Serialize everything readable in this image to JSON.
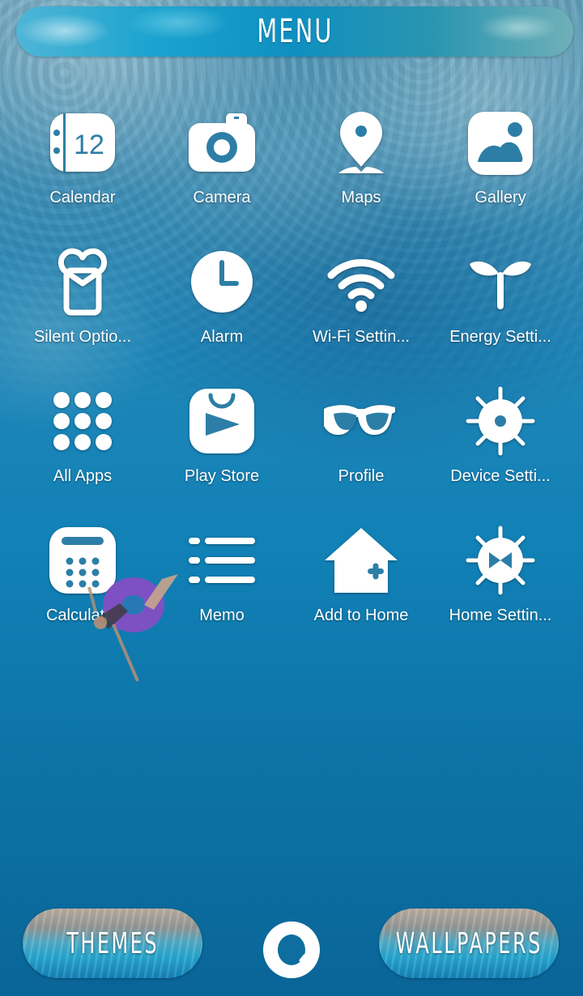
{
  "header": {
    "title": "MENU"
  },
  "apps": [
    {
      "label": "Calendar",
      "icon": "calendar-icon",
      "calendar_day": "12"
    },
    {
      "label": "Camera",
      "icon": "camera-icon"
    },
    {
      "label": "Maps",
      "icon": "map-pin-icon"
    },
    {
      "label": "Gallery",
      "icon": "gallery-icon"
    },
    {
      "label": "Silent Optio...",
      "icon": "silent-mode-icon"
    },
    {
      "label": "Alarm",
      "icon": "clock-icon"
    },
    {
      "label": "Wi-Fi Settin...",
      "icon": "wifi-icon"
    },
    {
      "label": "Energy Setti...",
      "icon": "sprout-icon"
    },
    {
      "label": "All Apps",
      "icon": "app-grid-icon"
    },
    {
      "label": "Play Store",
      "icon": "play-store-icon"
    },
    {
      "label": "Profile",
      "icon": "glasses-icon"
    },
    {
      "label": "Device Setti...",
      "icon": "gear-icon"
    },
    {
      "label": "Calculator",
      "icon": "calculator-icon"
    },
    {
      "label": "Memo",
      "icon": "list-icon"
    },
    {
      "label": "Add to Home",
      "icon": "add-home-icon"
    },
    {
      "label": "Home Settin...",
      "icon": "home-settings-icon"
    }
  ],
  "bottom_bar": {
    "themes_label": "THEMES",
    "wallpapers_label": "WALLPAPERS",
    "center_icon": "swim-ring-icon"
  },
  "colors": {
    "icon_fill": "#ffffff",
    "icon_cutout": "#2c7ea6",
    "background_deep": "#0a6597"
  }
}
